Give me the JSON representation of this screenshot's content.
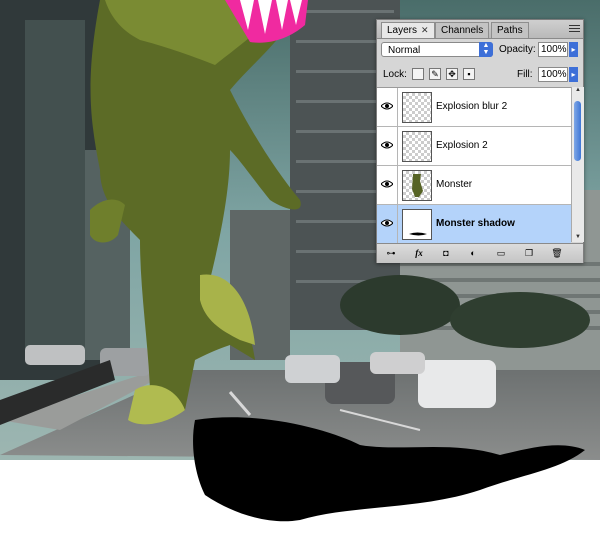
{
  "panel": {
    "tabs": [
      {
        "label": "Layers",
        "active": true
      },
      {
        "label": "Channels",
        "active": false
      },
      {
        "label": "Paths",
        "active": false
      }
    ],
    "blend_mode": "Normal",
    "opacity_label": "Opacity:",
    "opacity_value": "100%",
    "lock_label": "Lock:",
    "fill_label": "Fill:",
    "fill_value": "100%",
    "layers": [
      {
        "name": "Explosion blur 2",
        "visible": true,
        "selected": false
      },
      {
        "name": "Explosion 2",
        "visible": true,
        "selected": false
      },
      {
        "name": "Monster",
        "visible": true,
        "selected": false
      },
      {
        "name": "Monster shadow",
        "visible": true,
        "selected": true
      }
    ],
    "bottom_icons": [
      "link-icon",
      "fx-icon",
      "mask-icon",
      "adjustment-icon",
      "group-folder-icon",
      "new-layer-icon",
      "trash-icon"
    ],
    "bottom_fx_label": "fx"
  },
  "colors": {
    "selection": "#b4d3fa",
    "accent": "#3d6fd8"
  }
}
